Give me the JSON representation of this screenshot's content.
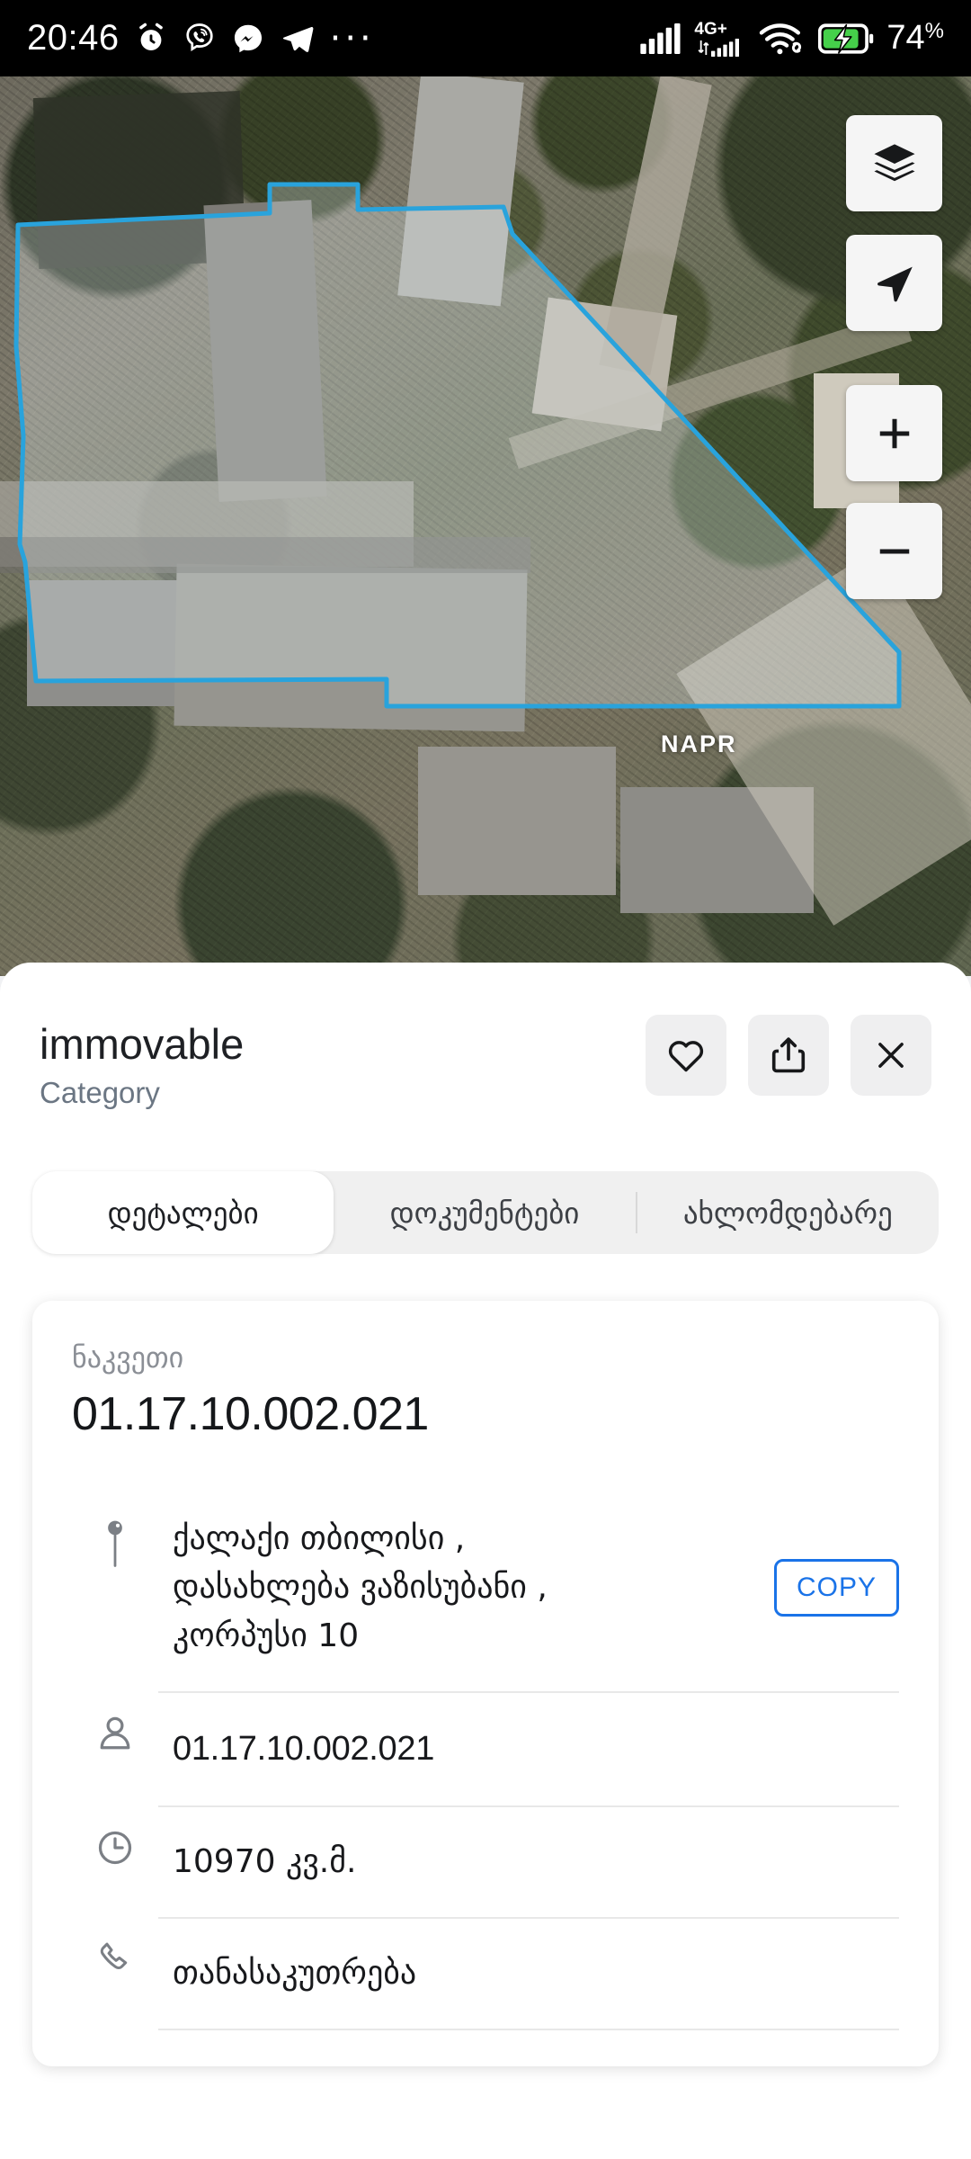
{
  "status_bar": {
    "time": "20:46",
    "left_icons": [
      "alarm-clock-icon",
      "viber-icon",
      "messenger-icon",
      "telegram-icon",
      "more-dots-icon"
    ],
    "overflow": "···",
    "network_type": "4G+",
    "right_icons": [
      "signal-bars-icon",
      "mobile-data-icon",
      "wifi-icon",
      "battery-charging-icon"
    ],
    "battery_percent": "74",
    "battery_percent_symbol": "%",
    "battery_color": "#45d04a"
  },
  "map": {
    "watermark": "NAPR",
    "parcel_outline_color": "#29A3DC",
    "parcel_fill_color": "rgba(225,235,240,0.32)",
    "controls": [
      {
        "name": "layers-button",
        "icon": "layers-icon"
      },
      {
        "name": "locate-button",
        "icon": "navigation-arrow-icon"
      },
      {
        "name": "zoom-in-button",
        "icon": "plus-icon",
        "label": "+"
      },
      {
        "name": "zoom-out-button",
        "icon": "minus-icon",
        "label": "−"
      }
    ]
  },
  "sheet": {
    "title": "immovable",
    "subtitle": "Category",
    "actions": [
      {
        "name": "favorite-button",
        "icon": "heart-icon"
      },
      {
        "name": "share-button",
        "icon": "share-icon"
      },
      {
        "name": "close-button",
        "icon": "close-icon"
      }
    ],
    "tabs": [
      {
        "label": "დეტალები",
        "active": true
      },
      {
        "label": "დოკუმენტები",
        "active": false
      },
      {
        "label": "ახლომდებარე",
        "active": false
      }
    ],
    "card": {
      "label": "ნაკვეთი",
      "code": "01.17.10.002.021",
      "rows": [
        {
          "icon": "map-pin-icon",
          "text": "ქალაქი თბილისი ,\nდასახლება ვაზისუბანი ,\nკორპუსი 10",
          "action_label": "COPY",
          "action_color": "#1a73e8"
        },
        {
          "icon": "person-icon",
          "text": "01.17.10.002.021",
          "mono": true
        },
        {
          "icon": "clock-icon",
          "text": "10970 კვ.მ."
        },
        {
          "icon": "phone-icon",
          "text": "თანასაკუთრება"
        }
      ]
    }
  }
}
